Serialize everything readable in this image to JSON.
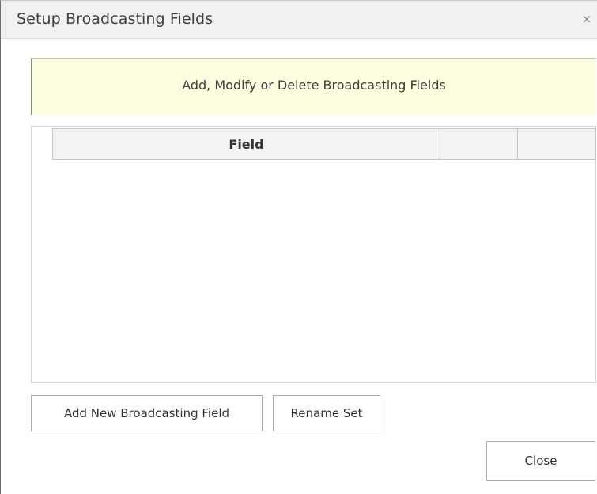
{
  "dialog": {
    "title": "Setup Broadcasting Fields",
    "close_glyph": "×"
  },
  "banner": {
    "text": "Add, Modify or Delete Broadcasting Fields",
    "background": "#fdfde0"
  },
  "grid": {
    "columns": [
      "Field",
      "",
      ""
    ],
    "rows": []
  },
  "buttons": {
    "add_field": "Add New Broadcasting Field",
    "rename_set": "Rename Set",
    "close": "Close"
  }
}
